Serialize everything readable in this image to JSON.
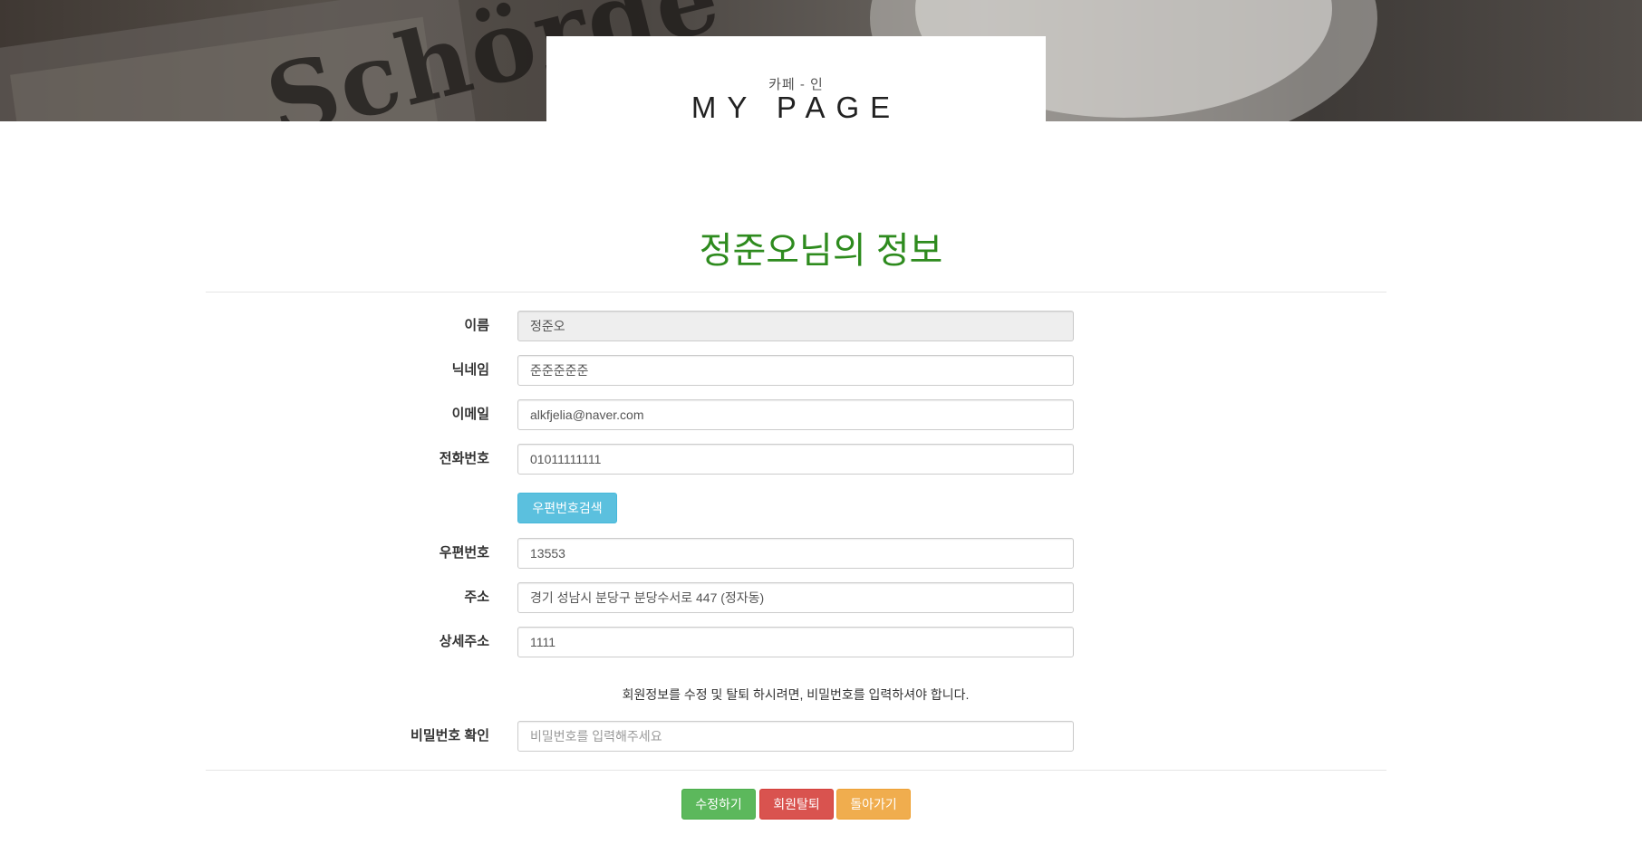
{
  "header": {
    "subtitle": "카페 - 인",
    "title": "MY PAGE",
    "background_words": "Schörde"
  },
  "page_title": "정준오님의 정보",
  "form": {
    "name": {
      "label": "이름",
      "value": "정준오"
    },
    "nickname": {
      "label": "닉네임",
      "value": "준준준준준"
    },
    "email": {
      "label": "이메일",
      "value": "alkfjelia@naver.com"
    },
    "phone": {
      "label": "전화번호",
      "value": "01011111111"
    },
    "zip_search_button": "우편번호검색",
    "zipcode": {
      "label": "우편번호",
      "value": "13553"
    },
    "address": {
      "label": "주소",
      "value": "경기 성남시 분당구 분당수서로 447 (정자동)"
    },
    "address_detail": {
      "label": "상세주소",
      "value": "1111"
    },
    "notice": "회원정보를 수정 및 탈퇴 하시려면, 비밀번호를 입력하셔야 합니다.",
    "password_confirm": {
      "label": "비밀번호 확인",
      "placeholder": "비밀번호를 입력해주세요"
    }
  },
  "actions": {
    "edit": "수정하기",
    "withdraw": "회원탈퇴",
    "back": "돌아가기"
  },
  "colors": {
    "title_green": "#2e8b1e",
    "info": "#5bc0de",
    "success": "#5cb85c",
    "danger": "#d9534f",
    "warning": "#f0ad4e"
  }
}
